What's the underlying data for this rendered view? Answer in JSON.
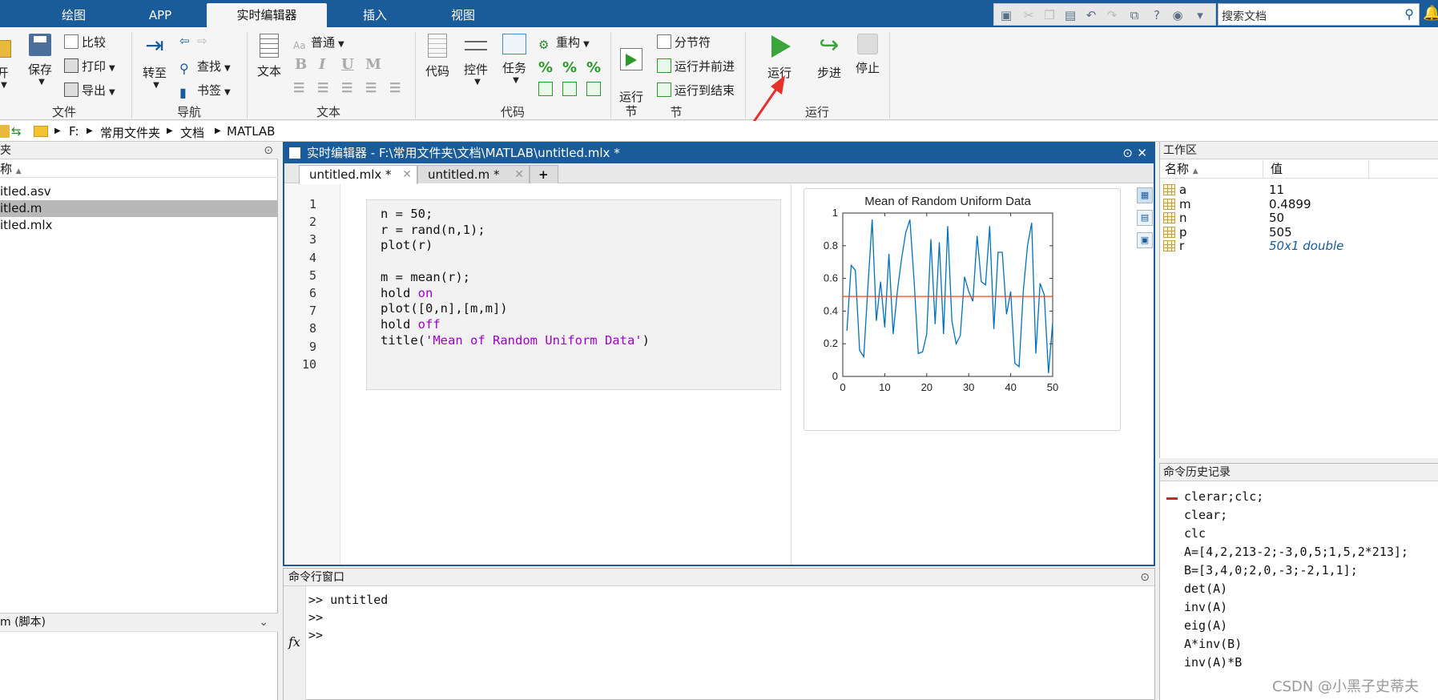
{
  "top_tabs": [
    "绘图",
    "APP",
    "实时编辑器",
    "插入",
    "视图"
  ],
  "search": {
    "placeholder": "搜索文档"
  },
  "ribbon": {
    "file": {
      "open": "开",
      "save": "保存",
      "compare": "比较",
      "print": "打印",
      "export": "导出",
      "label": "文件"
    },
    "nav": {
      "goto": "转至",
      "find": "查找",
      "bookmark": "书签",
      "label": "导航"
    },
    "text": {
      "text_btn": "文本",
      "style": "普通",
      "label": "文本"
    },
    "code": {
      "code_btn": "代码",
      "control": "控件",
      "task": "任务",
      "refactor": "重构",
      "label": "代码"
    },
    "section": {
      "run_section": "运行\n节",
      "break": "分节符",
      "run_advance": "运行并前进",
      "run_to_end": "运行到结束",
      "label": "节"
    },
    "run": {
      "run": "运行",
      "step": "步进",
      "stop": "停止",
      "label": "运行"
    }
  },
  "path": [
    "F:",
    "常用文件夹",
    "文档",
    "MATLAB"
  ],
  "left_panel": {
    "header": "夹",
    "col_name": "称",
    "files": [
      "itled.asv",
      "itled.m",
      "itled.mlx"
    ],
    "selected_index": 1,
    "detail": "m  (脚本)"
  },
  "editor": {
    "title": "实时编辑器 - F:\\常用文件夹\\文档\\MATLAB\\untitled.mlx *",
    "tabs": [
      "untitled.mlx *",
      "untitled.m *"
    ],
    "line_numbers": [
      "1",
      "2",
      "3",
      "4",
      "5",
      "6",
      "7",
      "8",
      "9",
      "10"
    ],
    "code": [
      {
        "plain": "n = 50;",
        "kw": ""
      },
      {
        "plain": "r = rand(n,1);",
        "kw": ""
      },
      {
        "plain": "plot(r)",
        "kw": ""
      },
      {
        "plain": "",
        "kw": ""
      },
      {
        "plain": "m = mean(r);",
        "kw": ""
      },
      {
        "plain": "hold ",
        "kw": "on"
      },
      {
        "plain": "plot([0,n],[m,m])",
        "kw": ""
      },
      {
        "plain": "hold ",
        "kw": "off"
      },
      {
        "plain": "title(",
        "kw": "'Mean of Random Uniform Data'",
        "tail": ")"
      },
      {
        "plain": "",
        "kw": ""
      }
    ]
  },
  "chart_data": {
    "type": "line",
    "title": "Mean of Random Uniform Data",
    "xlabel": "",
    "ylabel": "",
    "xlim": [
      0,
      50
    ],
    "ylim": [
      0,
      1
    ],
    "xticks": [
      0,
      10,
      20,
      30,
      40,
      50
    ],
    "yticks": [
      0,
      0.2,
      0.4,
      0.6,
      0.8,
      1
    ],
    "series": [
      {
        "color": "#0072bd",
        "x": [
          1,
          2,
          3,
          4,
          5,
          6,
          7,
          8,
          9,
          10,
          11,
          12,
          13,
          14,
          15,
          16,
          17,
          18,
          19,
          20,
          21,
          22,
          23,
          24,
          25,
          26,
          27,
          28,
          29,
          30,
          31,
          32,
          33,
          34,
          35,
          36,
          37,
          38,
          39,
          40,
          41,
          42,
          43,
          44,
          45,
          46,
          47,
          48,
          49,
          50
        ],
        "values": [
          0.28,
          0.68,
          0.65,
          0.16,
          0.12,
          0.55,
          0.96,
          0.34,
          0.58,
          0.3,
          0.75,
          0.26,
          0.52,
          0.72,
          0.88,
          0.96,
          0.58,
          0.14,
          0.15,
          0.26,
          0.84,
          0.32,
          0.82,
          0.26,
          0.92,
          0.34,
          0.2,
          0.25,
          0.61,
          0.52,
          0.46,
          0.86,
          0.58,
          0.56,
          0.92,
          0.29,
          0.76,
          0.76,
          0.38,
          0.52,
          0.08,
          0.06,
          0.52,
          0.8,
          0.94,
          0.14,
          0.57,
          0.5,
          0.02,
          0.33
        ]
      },
      {
        "color": "#d95319",
        "x": [
          0,
          50
        ],
        "values": [
          0.4899,
          0.4899
        ]
      }
    ]
  },
  "command_window": {
    "header": "命令行窗口",
    "lines": [
      ">> untitled",
      ">>",
      ">>"
    ],
    "fx": "fx"
  },
  "workspace": {
    "header": "工作区",
    "col_name": "名称",
    "col_value": "值",
    "vars": [
      {
        "name": "a",
        "value": "11"
      },
      {
        "name": "m",
        "value": "0.4899"
      },
      {
        "name": "n",
        "value": "50"
      },
      {
        "name": "p",
        "value": "505"
      },
      {
        "name": "r",
        "value": "50x1 double"
      }
    ]
  },
  "history": {
    "header": "命令历史记录",
    "lines": [
      "clerar;clc;",
      "clear;",
      "clc",
      "A=[4,2,213-2;-3,0,5;1,5,2*213];",
      "B=[3,4,0;2,0,-3;-2,1,1];",
      "det(A)",
      "inv(A)",
      "eig(A)",
      "A*inv(B)",
      "inv(A)*B"
    ]
  },
  "watermark": "CSDN @小黑子史蒂夫",
  "colors": {
    "accent": "#1a5b9a",
    "annotation_arrow": "#e8302a"
  }
}
